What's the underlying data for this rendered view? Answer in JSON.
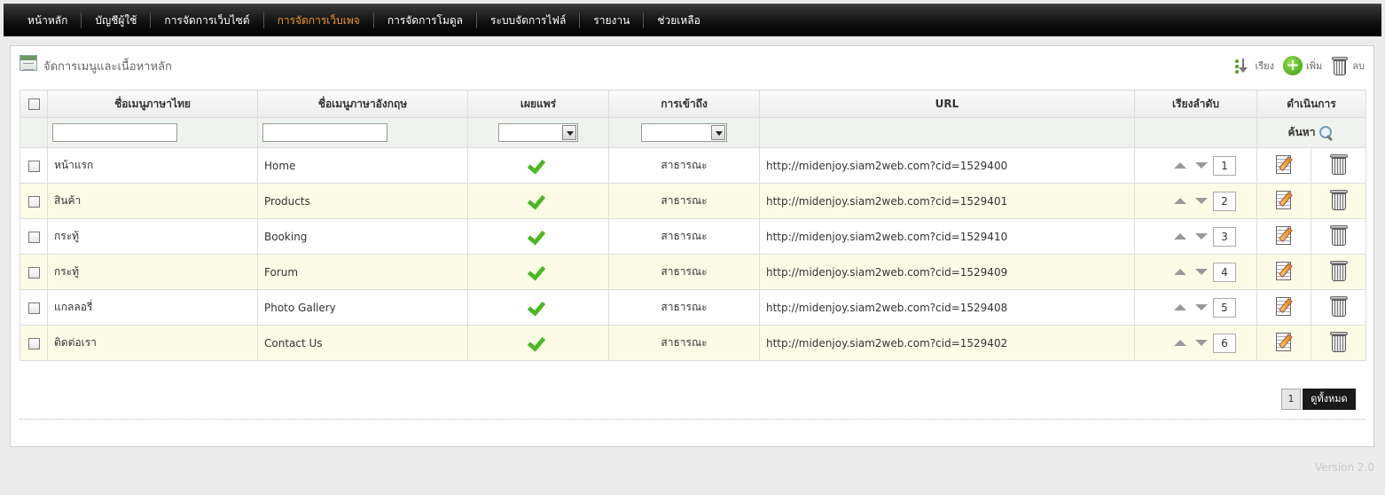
{
  "nav": {
    "items": [
      {
        "label": "หน้าหลัก",
        "active": false
      },
      {
        "label": "บัญชีผู้ใช้",
        "active": false
      },
      {
        "label": "การจัดการเว็บไซต์",
        "active": false
      },
      {
        "label": "การจัดการเว็บเพจ",
        "active": true
      },
      {
        "label": "การจัดการโมดูล",
        "active": false
      },
      {
        "label": "ระบบจัดการไฟล์",
        "active": false
      },
      {
        "label": "รายงาน",
        "active": false
      },
      {
        "label": "ช่วยเหลือ",
        "active": false
      }
    ],
    "active_color": "#f39a1e"
  },
  "panel": {
    "title": "จัดการเมนูและเนื้อหาหลัก",
    "toolbar": {
      "sort_label": "เรียง",
      "add_label": "เพิ่ม",
      "delete_label": "ลบ"
    }
  },
  "table": {
    "headers": {
      "thai_name": "ชื่อเมนูภาษาไทย",
      "eng_name": "ชื่อเมนูภาษาอังกฤษ",
      "publish": "เผยแพร่",
      "access": "การเข้าถึง",
      "url": "URL",
      "order": "เรียงลำดับ",
      "action": "ดำเนินการ"
    },
    "filter": {
      "thai_value": "",
      "eng_value": "",
      "publish_value": "",
      "access_value": "",
      "search_label": "ค้นหา"
    },
    "rows": [
      {
        "thai": "หน้าแรก",
        "eng": "Home",
        "published": true,
        "access": "สาธารณะ",
        "url": "http://midenjoy.siam2web.com?cid=1529400",
        "order": "1"
      },
      {
        "thai": "สินค้า",
        "eng": "Products",
        "published": true,
        "access": "สาธารณะ",
        "url": "http://midenjoy.siam2web.com?cid=1529401",
        "order": "2"
      },
      {
        "thai": "กระทู้",
        "eng": "Booking",
        "published": true,
        "access": "สาธารณะ",
        "url": "http://midenjoy.siam2web.com?cid=1529410",
        "order": "3"
      },
      {
        "thai": "กระทู้",
        "eng": "Forum",
        "published": true,
        "access": "สาธารณะ",
        "url": "http://midenjoy.siam2web.com?cid=1529409",
        "order": "4"
      },
      {
        "thai": "แกลลอรี่",
        "eng": "Photo Gallery",
        "published": true,
        "access": "สาธารณะ",
        "url": "http://midenjoy.siam2web.com?cid=1529408",
        "order": "5"
      },
      {
        "thai": "ติดต่อเรา",
        "eng": "Contact Us",
        "published": true,
        "access": "สาธารณะ",
        "url": "http://midenjoy.siam2web.com?cid=1529402",
        "order": "6"
      }
    ]
  },
  "pager": {
    "current_page": "1",
    "view_all_label": "ดูทั้งหมด"
  },
  "footer": {
    "version": "Version 2.0"
  }
}
